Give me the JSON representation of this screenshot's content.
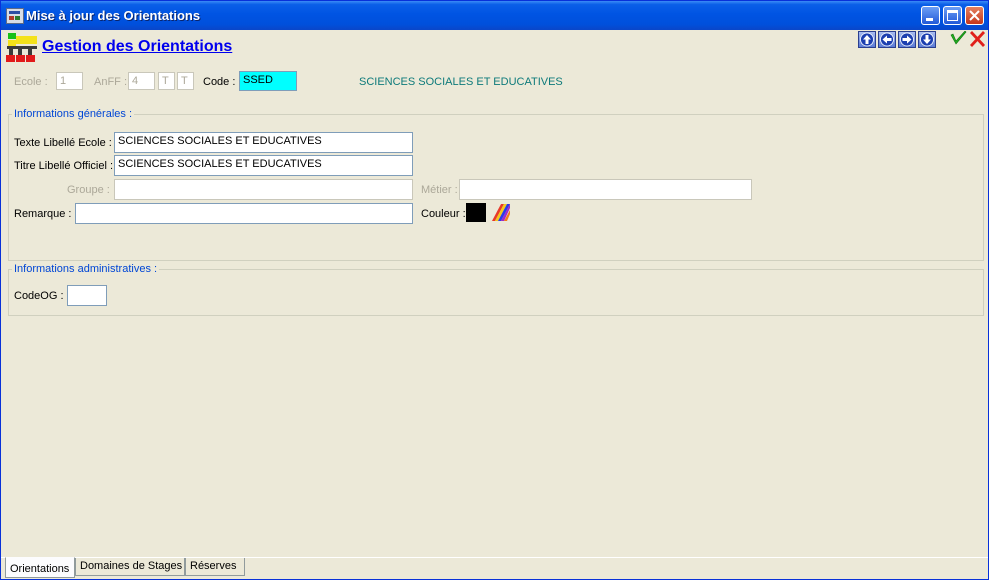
{
  "window": {
    "title": "Mise à jour des Orientations"
  },
  "header": {
    "title": "Gestion des Orientations"
  },
  "toolbar": {
    "nav_icons": [
      "arrow-up-icon",
      "arrow-left-icon",
      "arrow-right-icon",
      "arrow-down-icon"
    ],
    "ok_icon": "check-icon",
    "cancel_icon": "close-icon"
  },
  "filters": {
    "ecole_label": "Ecole :",
    "ecole_value": "1",
    "anff_label": "AnFF :",
    "anff_value": "4",
    "anff_t1": "T",
    "anff_t2": "T",
    "code_label": "Code :",
    "code_value": "SSED",
    "code_description": "SCIENCES SOCIALES ET EDUCATIVES"
  },
  "general": {
    "title": "Informations générales :",
    "texte_label": "Texte Libellé Ecole :",
    "texte_value": "SCIENCES SOCIALES ET EDUCATIVES",
    "titre_label": "Titre Libellé Officiel :",
    "titre_value": "SCIENCES SOCIALES ET EDUCATIVES",
    "groupe_label": "Groupe :",
    "groupe_value": "",
    "metier_label": "Métier :",
    "metier_value": "",
    "remarque_label": "Remarque :",
    "remarque_value": "",
    "couleur_label": "Couleur :",
    "couleur_value": "#000000"
  },
  "admin": {
    "title": "Informations administratives :",
    "codeog_label": "CodeOG :",
    "codeog_value": ""
  },
  "tabs": [
    {
      "label": "Orientations",
      "active": true
    },
    {
      "label": "Domaines de Stages",
      "active": false
    },
    {
      "label": "Réserves",
      "active": false
    }
  ]
}
